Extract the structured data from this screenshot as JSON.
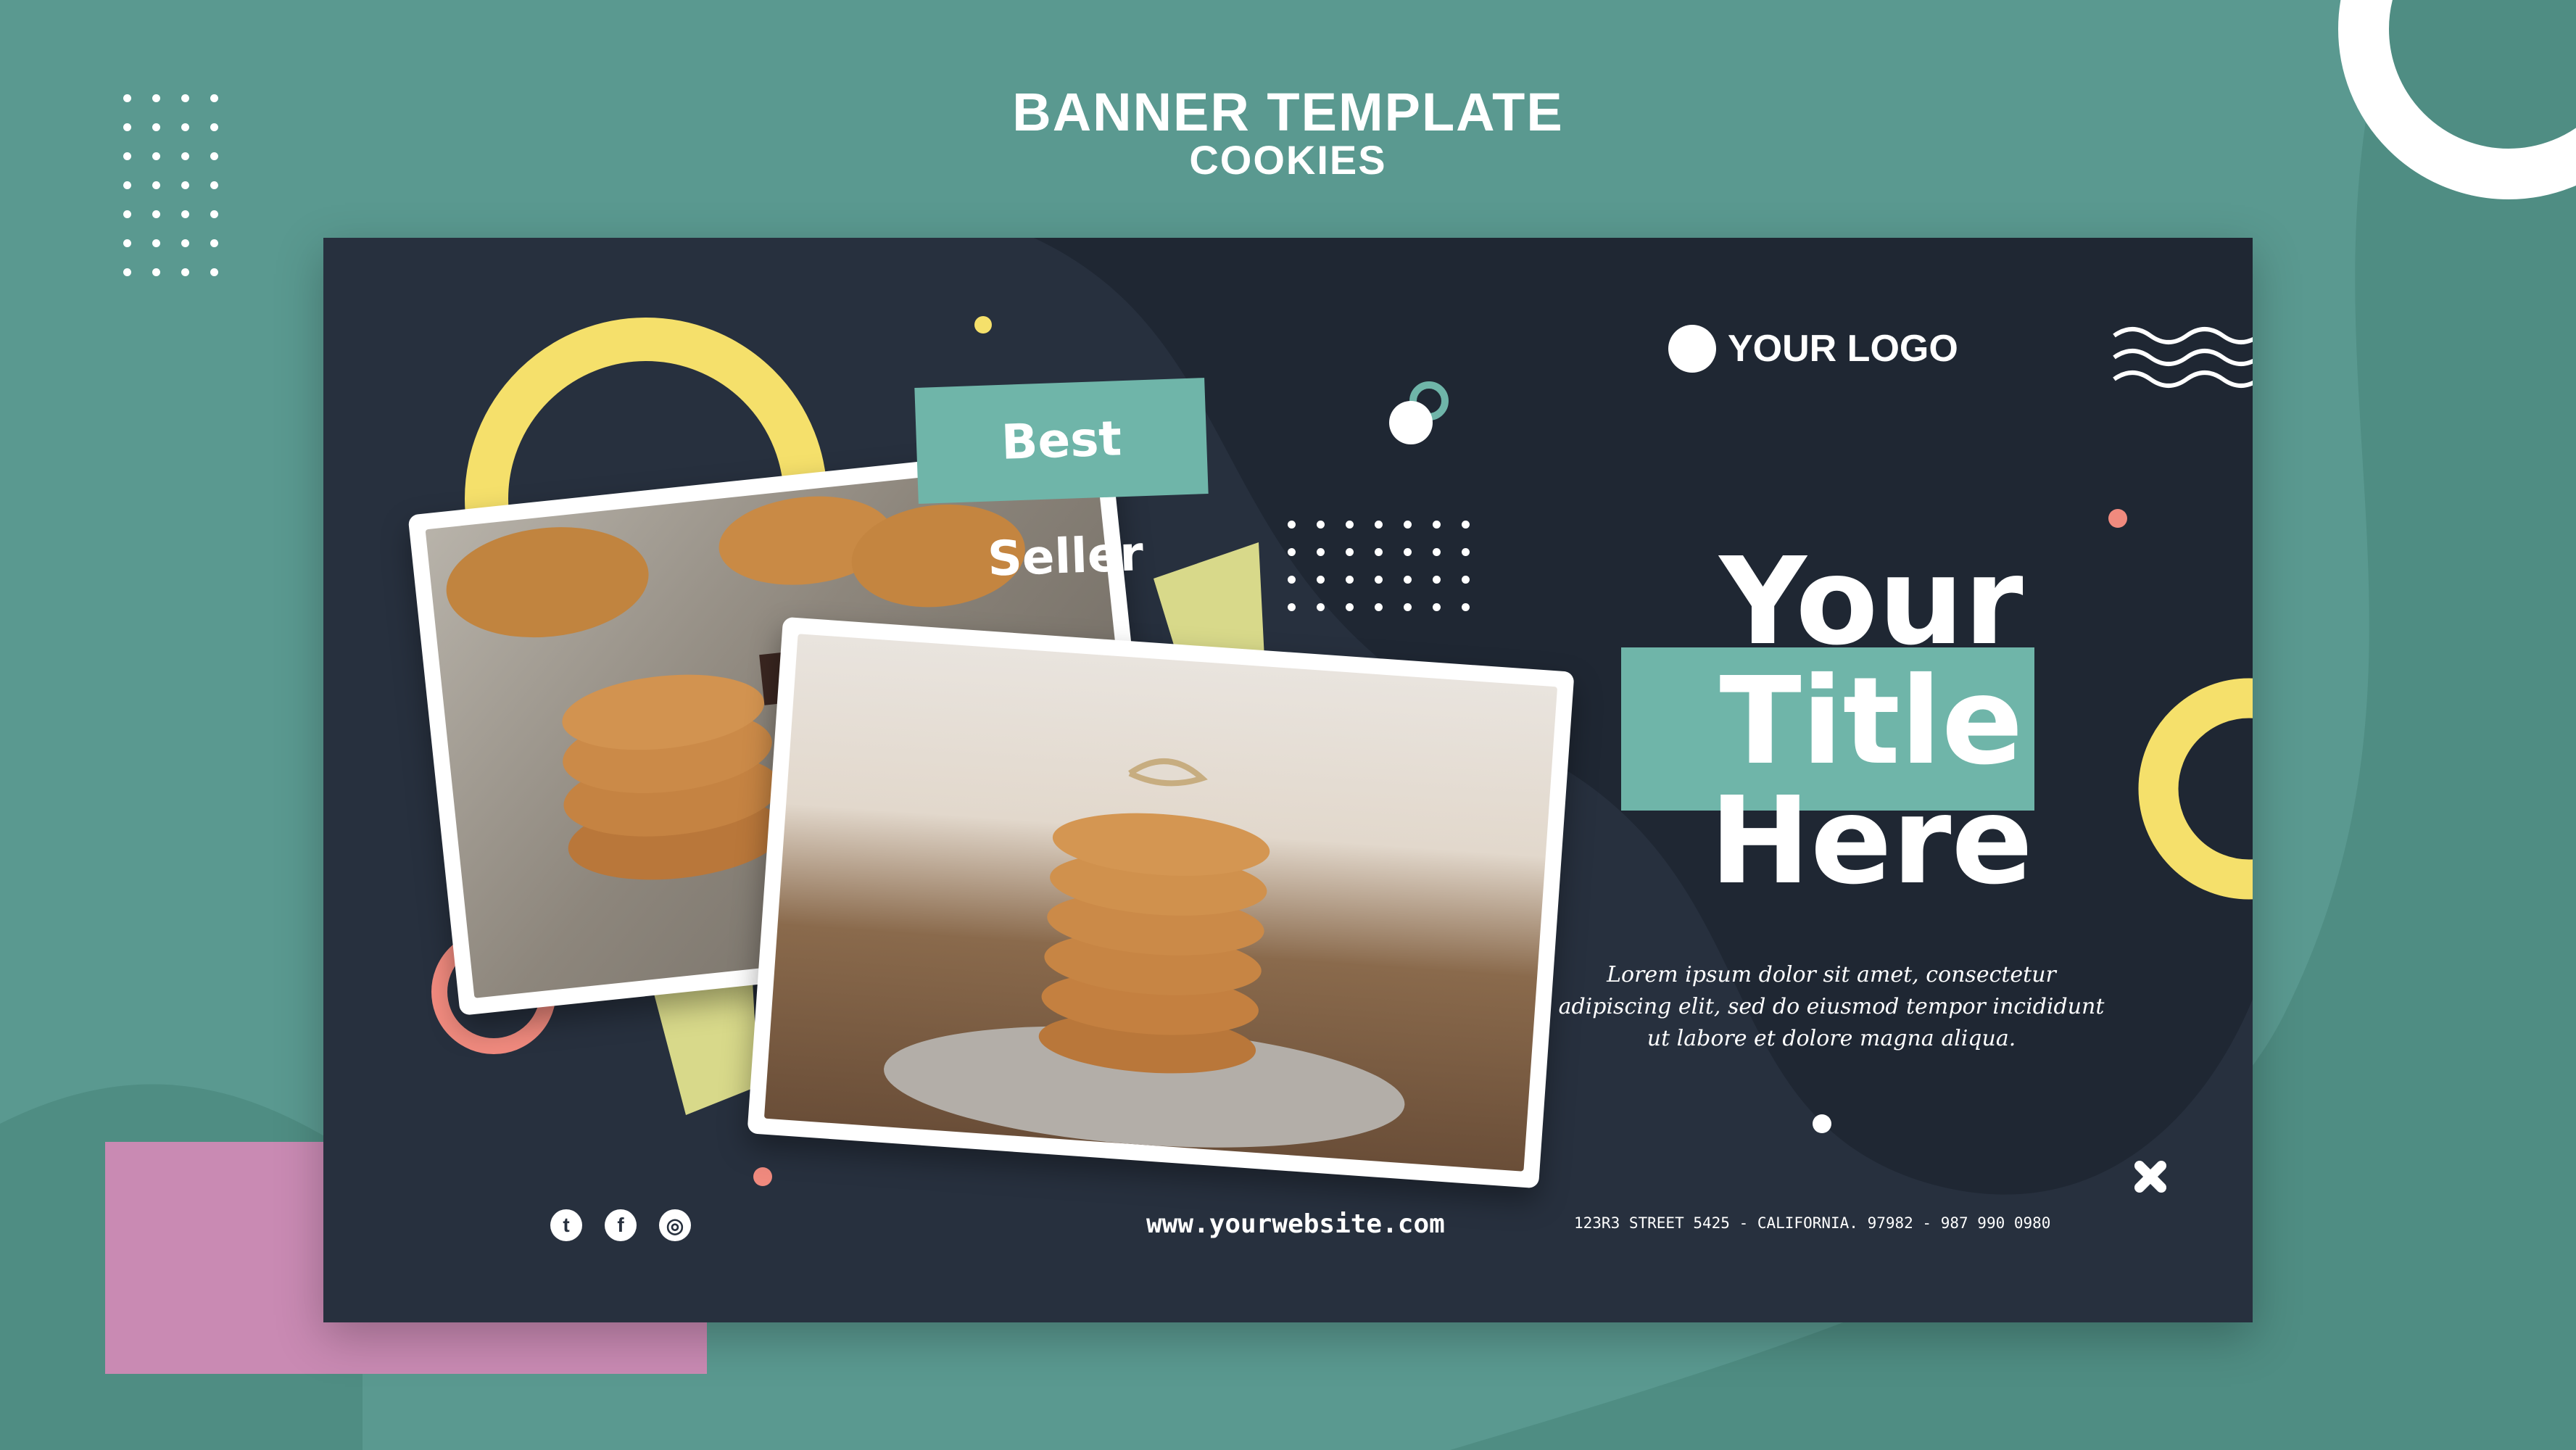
{
  "header": {
    "title": "BANNER TEMPLATE",
    "subtitle": "COOKIES"
  },
  "banner": {
    "badge": "Best Seller",
    "logo": "YOUR LOGO",
    "title_lines": [
      "Your",
      "Title",
      "Here"
    ],
    "body": "Lorem ipsum dolor sit amet, consectetur adipiscing elit, sed do eiusmod tempor incididunt ut labore et dolore magna aliqua.",
    "website": "www.yourwebsite.com",
    "address": "123R3 STREET 5425 - CALIFORNIA. 97982 - 987 990 0980",
    "social": [
      {
        "icon": "twitter-icon",
        "glyph": "t"
      },
      {
        "icon": "facebook-icon",
        "glyph": "f"
      },
      {
        "icon": "instagram-icon",
        "glyph": "◎"
      }
    ]
  },
  "colors": {
    "background": "#5a9990",
    "banner": "#27303e",
    "teal_label": "#6fb5a9",
    "yellow": "#f5e06b",
    "pink": "#f08a7e",
    "lavender": "#c98ab3",
    "lime": "#d8d98a"
  }
}
